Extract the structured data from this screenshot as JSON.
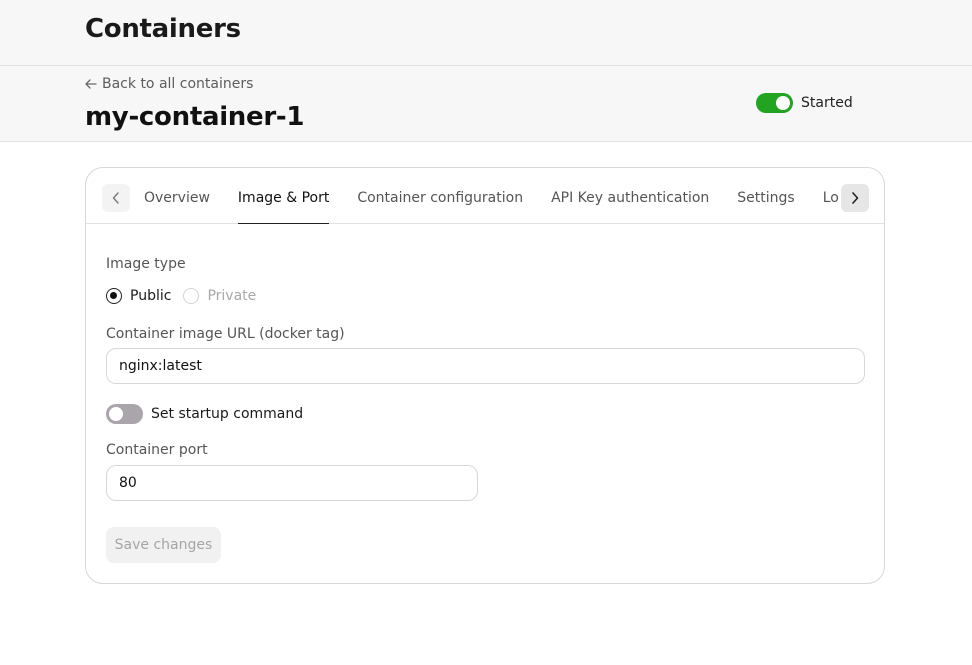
{
  "page": {
    "title": "Containers"
  },
  "header": {
    "back_link": "Back to all containers",
    "container_name": "my-container-1",
    "status_label": "Started",
    "status_on": true,
    "accent_color": "#22a322"
  },
  "tabs": [
    {
      "label": "Overview",
      "active": false
    },
    {
      "label": "Image & Port",
      "active": true
    },
    {
      "label": "Container configuration",
      "active": false
    },
    {
      "label": "API Key authentication",
      "active": false
    },
    {
      "label": "Settings",
      "active": false
    },
    {
      "label": "Logs",
      "active": false
    }
  ],
  "form": {
    "image_type_label": "Image type",
    "radio_public": "Public",
    "radio_private": "Private",
    "selected_image_type": "Public",
    "image_url_label": "Container image URL (docker tag)",
    "image_url_value": "nginx:latest",
    "startup_command_label": "Set startup command",
    "startup_command_enabled": false,
    "port_label": "Container port",
    "port_value": "80",
    "save_button": "Save changes"
  }
}
